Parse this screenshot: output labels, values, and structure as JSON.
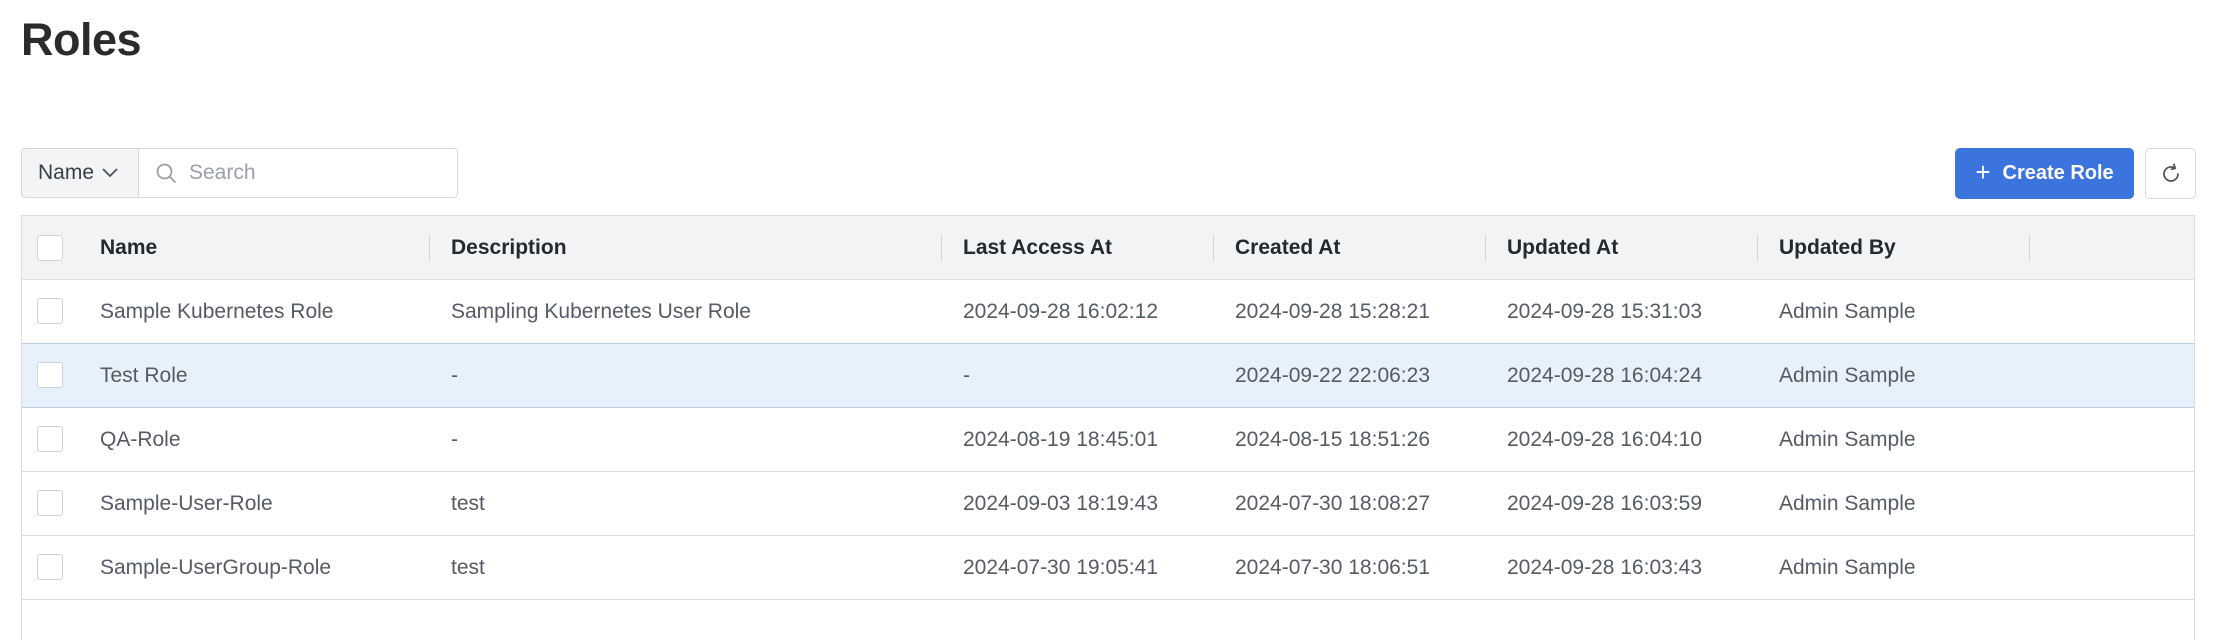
{
  "page": {
    "title": "Roles"
  },
  "toolbar": {
    "filter_field": "Name",
    "search_placeholder": "Search",
    "search_value": "",
    "create_label": "Create Role",
    "refresh_icon": "refresh-icon",
    "search_icon": "search-icon",
    "chevron_icon": "chevron-down-icon",
    "accent_color": "#3b74dd"
  },
  "table": {
    "columns": [
      "Name",
      "Description",
      "Last Access At",
      "Created At",
      "Updated At",
      "Updated By"
    ],
    "rows": [
      {
        "name": "Sample Kubernetes Role",
        "description": "Sampling Kubernetes User Role",
        "last_access_at": "2024-09-28 16:02:12",
        "created_at": "2024-09-28 15:28:21",
        "updated_at": "2024-09-28 15:31:03",
        "updated_by": "Admin Sample",
        "highlighted": false
      },
      {
        "name": "Test Role",
        "description": "-",
        "last_access_at": "-",
        "created_at": "2024-09-22 22:06:23",
        "updated_at": "2024-09-28 16:04:24",
        "updated_by": "Admin Sample",
        "highlighted": true
      },
      {
        "name": "QA-Role",
        "description": "-",
        "last_access_at": "2024-08-19 18:45:01",
        "created_at": "2024-08-15 18:51:26",
        "updated_at": "2024-09-28 16:04:10",
        "updated_by": "Admin Sample",
        "highlighted": false
      },
      {
        "name": "Sample-User-Role",
        "description": "test",
        "last_access_at": "2024-09-03 18:19:43",
        "created_at": "2024-07-30 18:08:27",
        "updated_at": "2024-09-28 16:03:59",
        "updated_by": "Admin Sample",
        "highlighted": false
      },
      {
        "name": "Sample-UserGroup-Role",
        "description": "test",
        "last_access_at": "2024-07-30 19:05:41",
        "created_at": "2024-07-30 18:06:51",
        "updated_at": "2024-09-28 16:03:43",
        "updated_by": "Admin Sample",
        "highlighted": false
      }
    ]
  }
}
